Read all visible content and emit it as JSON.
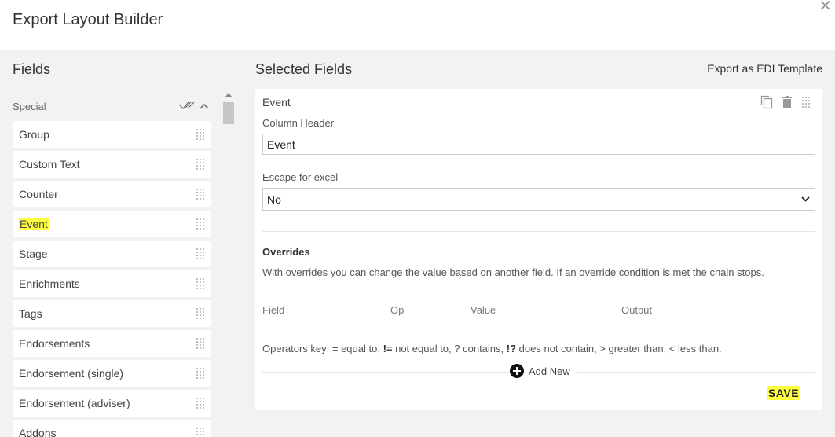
{
  "dialog": {
    "title": "Export Layout Builder",
    "close_icon": "close-icon"
  },
  "fields_panel": {
    "title": "Fields",
    "section_label": "Special",
    "items": [
      {
        "label": "Group",
        "highlighted": false
      },
      {
        "label": "Custom Text",
        "highlighted": false
      },
      {
        "label": "Counter",
        "highlighted": false
      },
      {
        "label": "Event",
        "highlighted": true
      },
      {
        "label": "Stage",
        "highlighted": false
      },
      {
        "label": "Enrichments",
        "highlighted": false
      },
      {
        "label": "Tags",
        "highlighted": false
      },
      {
        "label": "Endorsements",
        "highlighted": false
      },
      {
        "label": "Endorsement (single)",
        "highlighted": false
      },
      {
        "label": "Endorsement (adviser)",
        "highlighted": false
      },
      {
        "label": "Addons",
        "highlighted": false
      }
    ]
  },
  "selected_panel": {
    "title": "Selected Fields",
    "edi_link": "Export as EDI Template",
    "card": {
      "title": "Event",
      "column_header_label": "Column Header",
      "column_header_value": "Event",
      "escape_label": "Escape for excel",
      "escape_value": "No",
      "overrides": {
        "title": "Overrides",
        "description": "With overrides you can change the value based on another field. If an override condition is met the chain stops.",
        "columns": [
          "Field",
          "Op",
          "Value",
          "Output"
        ],
        "key_prefix": "Operators key: = equal to, ",
        "key_neq_op": "!=",
        "key_neq": " not equal to, ? contains, ",
        "key_nc_op": "!?",
        "key_nc": " does not contain, > greater than, < less than."
      },
      "add_new_label": "Add New",
      "save_label": "SAVE"
    }
  },
  "colors": {
    "highlight": "#ffff3d",
    "panel_bg": "#f2f2f2"
  }
}
